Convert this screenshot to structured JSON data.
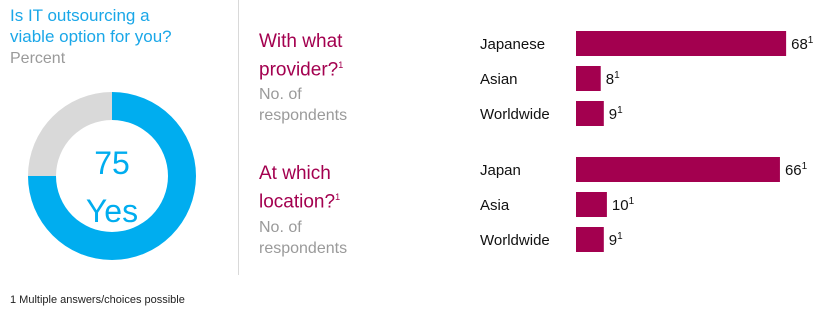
{
  "left_panel": {
    "title_line1": "Is IT outsourcing a",
    "title_line2": "viable option for you?",
    "unit": "Percent",
    "donut_value": "75",
    "donut_label": "Yes"
  },
  "sections": [
    {
      "title_line1": "With what",
      "title_line2": "provider?",
      "title_sup": "1",
      "unit_line1": "No. of",
      "unit_line2": "respondents"
    },
    {
      "title_line1": "At which",
      "title_line2": "location?",
      "title_sup": "1",
      "unit_line1": "No. of",
      "unit_line2": "respondents"
    }
  ],
  "footnote": "1 Multiple answers/choices possible",
  "colors": {
    "donut_yes": "#00adef",
    "donut_rest": "#d9d9d9",
    "bar": "#a3004f",
    "title_blue": "#1aa7e8",
    "title_magenta": "#a3004f"
  },
  "chart_data": [
    {
      "type": "pie",
      "title": "Is IT outsourcing a viable option for you?",
      "unit": "Percent",
      "categories": [
        "Yes",
        ""
      ],
      "values": [
        75,
        25
      ]
    },
    {
      "type": "bar",
      "orientation": "horizontal",
      "title": "With what provider?",
      "unit": "No. of respondents",
      "categories": [
        "Japanese",
        "Asian",
        "Worldwide"
      ],
      "values": [
        68,
        8,
        9
      ],
      "value_suffix": "1"
    },
    {
      "type": "bar",
      "orientation": "horizontal",
      "title": "At which location?",
      "unit": "No. of respondents",
      "categories": [
        "Japan",
        "Asia",
        "Worldwide"
      ],
      "values": [
        66,
        10,
        9
      ],
      "value_suffix": "1"
    }
  ]
}
